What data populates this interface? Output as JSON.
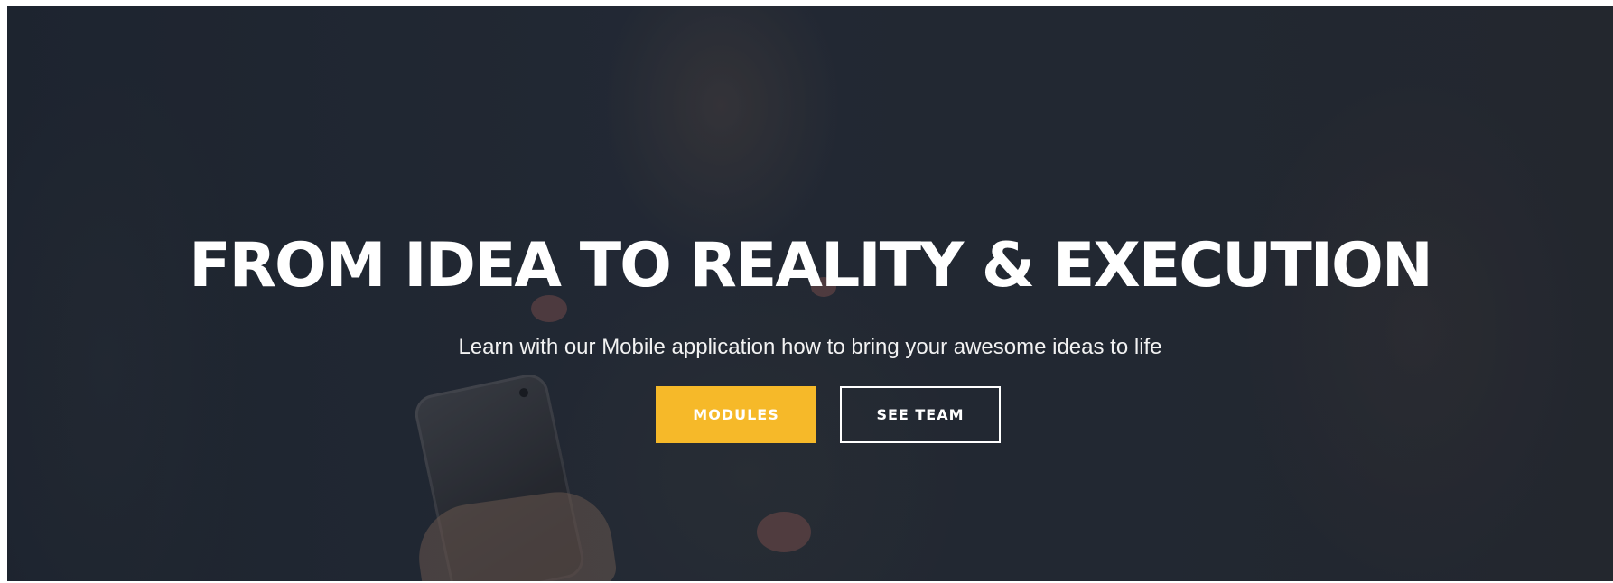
{
  "hero": {
    "title": "FROM IDEA TO REALITY & EXECUTION",
    "subtitle": "Learn with our Mobile application how to bring your awesome ideas to life",
    "buttons": {
      "primary_label": "MODULES",
      "secondary_label": "SEE TEAM"
    },
    "colors": {
      "primary_button": "#f6b929",
      "overlay": "#262d38",
      "text": "#ffffff"
    }
  }
}
